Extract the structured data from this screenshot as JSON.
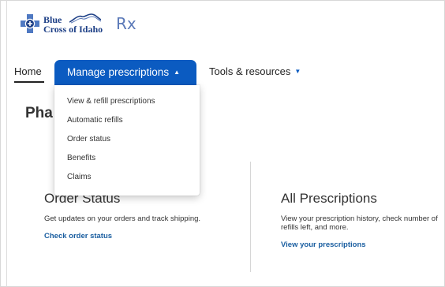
{
  "logo": {
    "line1": "Blue",
    "line2": "Cross of Idaho",
    "rx": "Rx",
    "colors": {
      "navy": "#1d3f86",
      "light": "#5b79b8"
    }
  },
  "nav": {
    "home": "Home",
    "manage": "Manage prescriptions",
    "tools": "Tools & resources",
    "caret_up": "▲",
    "caret_down": "▼",
    "accent": "#0b5bc1"
  },
  "dropdown": {
    "items": [
      "View & refill prescriptions",
      "Automatic refills",
      "Order status",
      "Benefits",
      "Claims"
    ]
  },
  "page": {
    "title_partial": "Pha"
  },
  "cards": {
    "left": {
      "title": "Order Status",
      "desc": "Get updates on your orders and track shipping.",
      "link": "Check order status"
    },
    "right": {
      "title": "All Prescriptions",
      "desc": "View your prescription history, check number of refills left, and more.",
      "link": "View your prescriptions"
    },
    "link_color": "#1a5ea0"
  }
}
